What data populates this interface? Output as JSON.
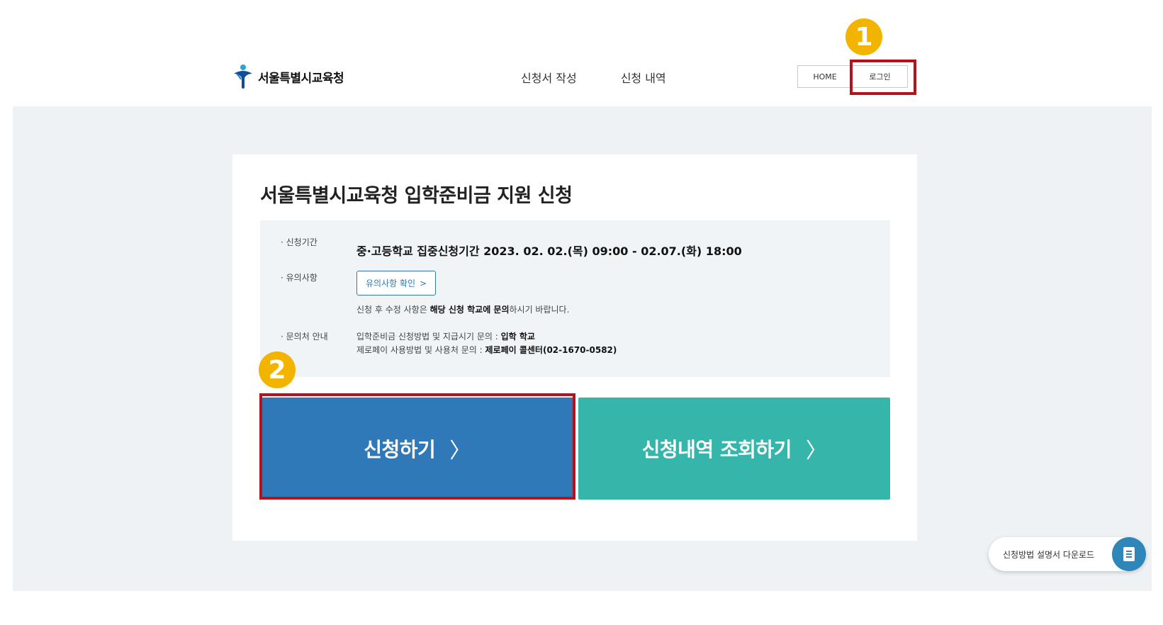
{
  "header": {
    "logo_text": "서울특별시교육청",
    "nav": [
      "신청서 작성",
      "신청 내역"
    ],
    "home_label": "HOME",
    "login_label": "로그인"
  },
  "markers": [
    "1",
    "2"
  ],
  "main": {
    "title": "서울특별시교육청 입학준비금 지원 신청",
    "period_label": "· 신청기간",
    "period_value": "중·고등학교 집중신청기간 2023. 02. 02.(목) 09:00 - 02.07.(화) 18:00",
    "notice_label": "· 유의사항",
    "notice_button": "유의사항 확인",
    "notice_text_pre": "신청 후 수정 사항은 ",
    "notice_text_bold": "해당 신청 학교에 문의",
    "notice_text_post": "하시기 바랍니다.",
    "contact_label": "· 문의처 안내",
    "contact1_pre": "입학준비금 신청방법 및 지급시기 문의 : ",
    "contact1_bold": "입학 학교",
    "contact2_pre": "제로페이 사용방법 및 사용처 문의 : ",
    "contact2_bold": "제로페이 콜센터(02-1670-0582)"
  },
  "buttons": {
    "apply": "신청하기",
    "history": "신청내역 조회하기",
    "chevron": "〉"
  },
  "float": {
    "label": "신청방법 설명서 다운로드"
  },
  "colors": {
    "apply_btn": "#3079b8",
    "history_btn": "#36b5aa",
    "highlight_box": "#b5121b",
    "marker": "#f3b400",
    "band_bg": "#eef2f5"
  }
}
